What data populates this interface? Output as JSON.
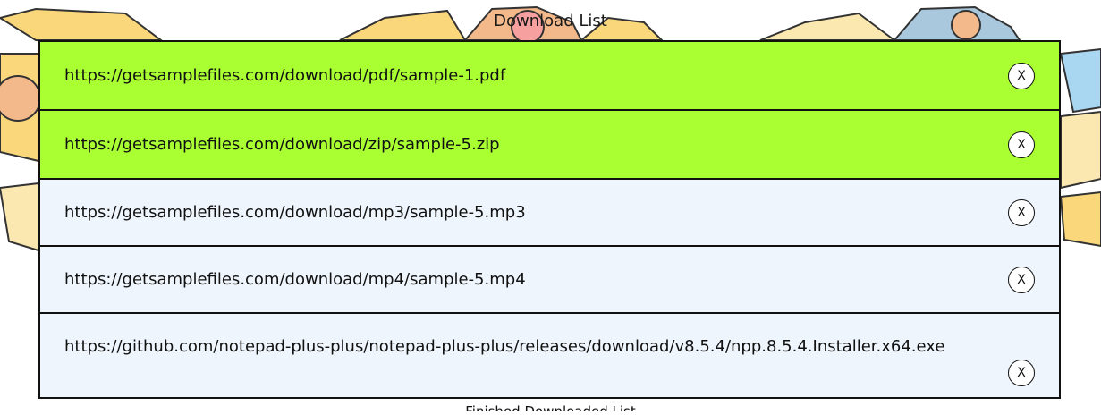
{
  "header": {
    "title": "Download List"
  },
  "downloads": [
    {
      "url": "https://getsamplefiles.com/download/pdf/sample-1.pdf",
      "status": "done",
      "close_label": "X"
    },
    {
      "url": "https://getsamplefiles.com/download/zip/sample-5.zip",
      "status": "done",
      "close_label": "X"
    },
    {
      "url": "https://getsamplefiles.com/download/mp3/sample-5.mp3",
      "status": "pending",
      "close_label": "X"
    },
    {
      "url": "https://getsamplefiles.com/download/mp4/sample-5.mp4",
      "status": "pending",
      "close_label": "X"
    },
    {
      "url": "https://github.com/notepad-plus-plus/notepad-plus-plus/releases/download/v8.5.4/npp.8.5.4.Installer.x64.exe",
      "status": "pending",
      "close_label": "X"
    }
  ],
  "footer": {
    "status_text": "Finished Downloaded List"
  },
  "colors": {
    "done": "#aaff33",
    "pending": "#eef5fc",
    "border": "#111111"
  }
}
